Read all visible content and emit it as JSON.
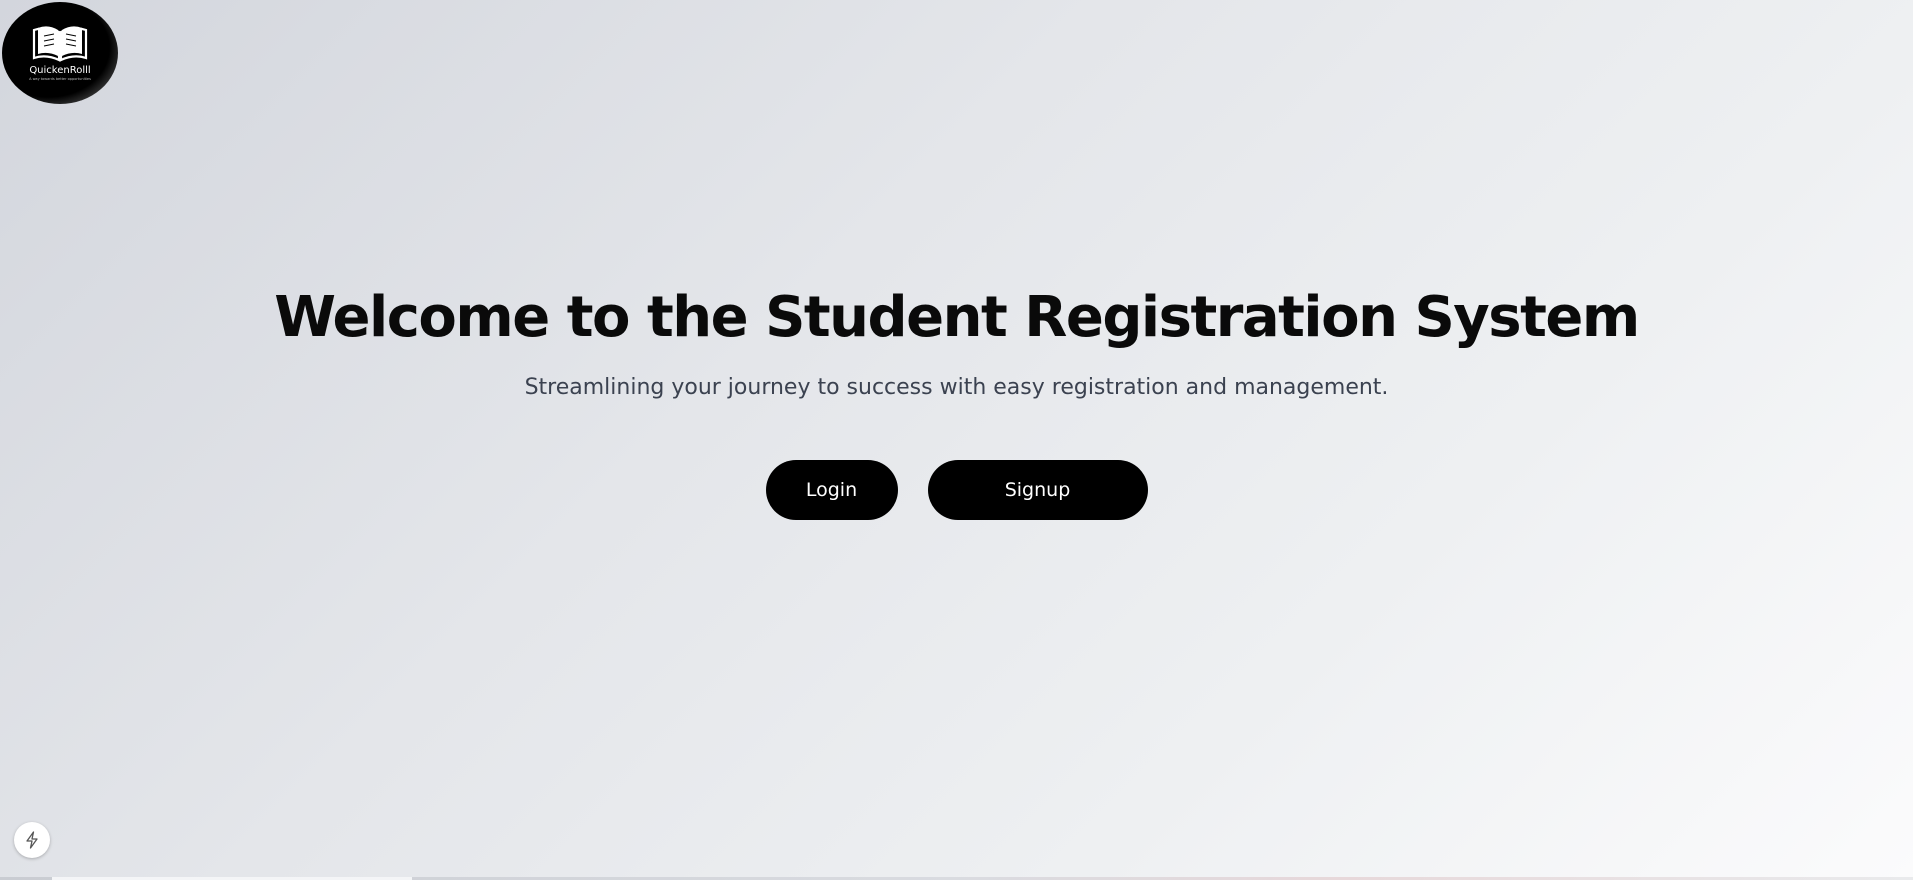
{
  "logo": {
    "name": "QuickenRolll",
    "tagline": "A way towards better opportunities",
    "icon": "open-book-icon"
  },
  "hero": {
    "title": "Welcome to the Student Registration System",
    "subtitle": "Streamlining your journey to success with easy registration and management."
  },
  "actions": {
    "login_label": "Login",
    "signup_label": "Signup"
  },
  "corner_badge": {
    "icon": "lightning-icon"
  },
  "colors": {
    "button_bg": "#000000",
    "button_text": "#ffffff",
    "title": "#0a0a0a",
    "subtitle": "#3b4250"
  }
}
